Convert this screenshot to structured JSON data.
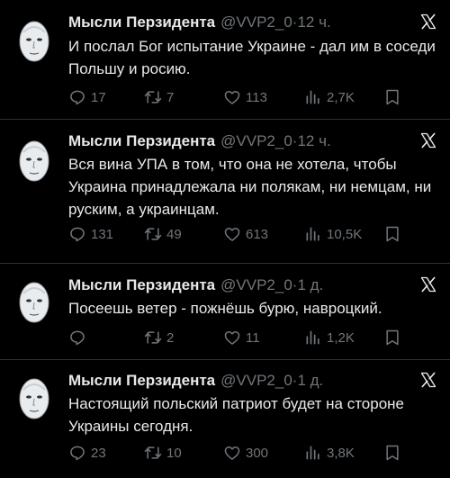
{
  "tweets": [
    {
      "name": "Мысли Перзидента",
      "handle": "@VVP2_0",
      "sep": "·",
      "time": "12 ч.",
      "text": "И послал Бог испытание Украине - дал им в соседи Польшу и росию.",
      "replies": "17",
      "retweets": "7",
      "likes": "113",
      "views": "2,7K"
    },
    {
      "name": "Мысли Перзидента",
      "handle": "@VVP2_0",
      "sep": "·",
      "time": "12 ч.",
      "text": "Вся вина УПА в том, что она не хотела, чтобы Украина принадлежала ни полякам, ни немцам, ни руским, а украинцам.",
      "replies": "131",
      "retweets": "49",
      "likes": "613",
      "views": "10,5K"
    },
    {
      "name": "Мысли Перзидента",
      "handle": "@VVP2_0",
      "sep": "·",
      "time": "1 д.",
      "text": "Посеешь ветер - пожнёшь бурю, навроцкий.",
      "replies": "",
      "retweets": "2",
      "likes": "11",
      "views": "1,2K"
    },
    {
      "name": "Мысли Перзидента",
      "handle": "@VVP2_0",
      "sep": "·",
      "time": "1 д.",
      "text": "Настоящий польский патриот будет на стороне Украины сегодня.",
      "replies": "23",
      "retweets": "10",
      "likes": "300",
      "views": "3,8K"
    }
  ]
}
